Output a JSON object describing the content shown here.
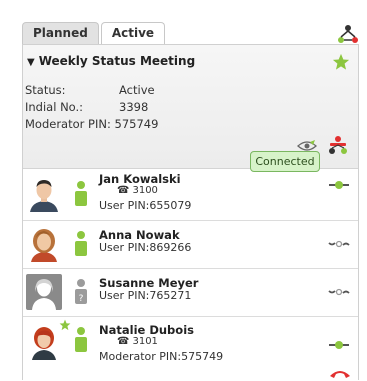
{
  "tabs": [
    {
      "label": "Planned",
      "active": false
    },
    {
      "label": "Active",
      "active": true
    }
  ],
  "conference": {
    "title": "Weekly Status Meeting",
    "status_label": "Status:",
    "status_value": "Active",
    "indial_label": "Indial No.:",
    "indial_value": "3398",
    "moderator_label": "Moderator PIN:",
    "moderator_value": "575749"
  },
  "tooltip": "Connected",
  "participants": [
    {
      "name": "Jan Kowalski",
      "extension": "3100",
      "pin": "User PIN:655079",
      "role": "user",
      "status": "connected",
      "favorite": false
    },
    {
      "name": "Anna Nowak",
      "extension": "",
      "pin": "User PIN:869266",
      "role": "user",
      "status": "idle",
      "favorite": false
    },
    {
      "name": "Susanne Meyer",
      "extension": "",
      "pin": "User PIN:765271",
      "role": "unknown",
      "status": "idle",
      "favorite": false
    },
    {
      "name": "Natalie Dubois",
      "extension": "3101",
      "pin": "Moderator PIN:575749",
      "role": "user",
      "status": "connected",
      "favorite": true
    }
  ],
  "colors": {
    "accent_green": "#8cc63f",
    "hangup_red": "#e23030",
    "tooltip_bg": "#d7f3c9"
  },
  "icons": {
    "conference": "conference-network-icon",
    "favorite": "star-icon",
    "hangup": "hangup-icon"
  }
}
